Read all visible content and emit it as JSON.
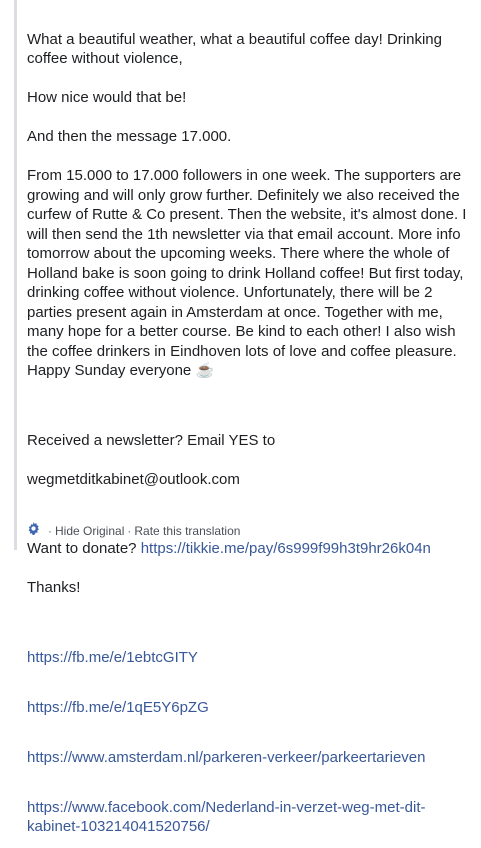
{
  "post": {
    "paragraph1_lines": [
      "What a beautiful weather, what a beautiful coffee day! Drinking coffee without violence,",
      "How nice would that be!",
      "And then the message 17.000.",
      "From 15.000 to 17.000 followers in one week. The supporters are growing and will only grow further. Definitely we also received the curfew of Rutte & Co present. Then the website, it's almost done. I will then send the 1th newsletter via that email account. More info tomorrow about the upcoming weeks. There where the whole of Holland bake is soon going to drink Holland coffee! But first today, drinking coffee without violence. Unfortunately, there will be 2 parties present again in Amsterdam at once. Together with me, many hope for a better course. Be kind to each other! I also wish the coffee drinkers in Eindhoven lots of love and coffee pleasure. Happy Sunday everyone ☕"
    ],
    "newsletter_text": "Received a newsletter? Email YES to",
    "email": "wegmetditkabinet@outlook.com",
    "donate_text": "Want to donate? ",
    "donate_link": "https://tikkie.me/pay/6s999f99h3t9hr26k04n",
    "thanks": "Thanks!",
    "links": [
      "https://fb.me/e/1ebtcGITY",
      "https://fb.me/e/1qE5Y6pZG",
      "https://www.amsterdam.nl/parkeren-verkeer/parkeertarieven",
      "https://www.facebook.com/Nederland-in-verzet-weg-met-dit-kabinet-103214041520756/"
    ]
  },
  "footer": {
    "gear_icon": "gear-icon",
    "hide_original": "Hide Original",
    "rate": "Rate this translation",
    "separator": "·"
  },
  "colors": {
    "link": "#385898",
    "text": "#1c1e21",
    "muted": "#606770",
    "gear": "#4267b2"
  }
}
